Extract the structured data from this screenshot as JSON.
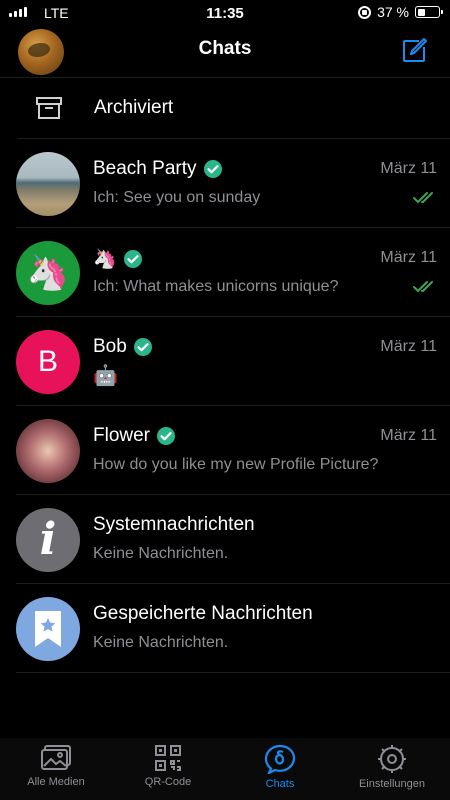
{
  "status_bar": {
    "carrier": "LTE",
    "time": "11:35",
    "battery": "37 %",
    "battery_level": 0.37
  },
  "header": {
    "title": "Chats"
  },
  "archived": {
    "label": "Archiviert"
  },
  "chats": [
    {
      "name": "Beach Party",
      "date": "März 11",
      "preview": "Ich: See you on sunday",
      "verified": true,
      "read": true
    },
    {
      "name": "🦄",
      "date": "März 11",
      "preview": "Ich: What makes unicorns unique?",
      "verified": true,
      "read": true,
      "avatar_emoji": "🦄",
      "avatar_color": "#1a9a3a"
    },
    {
      "name": "Bob",
      "date": "März 11",
      "preview": "🤖",
      "verified": true,
      "avatar_letter": "B",
      "avatar_color": "#e8125a"
    },
    {
      "name": "Flower",
      "date": "März 11",
      "preview": "How do you like my new Profile Picture?",
      "verified": true
    },
    {
      "name": "Systemnachrichten",
      "preview": "Keine Nachrichten.",
      "avatar_color": "#6d6d72"
    },
    {
      "name": "Gespeicherte Nachrichten",
      "preview": "Keine Nachrichten.",
      "avatar_color": "#7fa8e0"
    }
  ],
  "tabs": [
    {
      "label": "Alle Medien",
      "icon": "media-icon"
    },
    {
      "label": "QR-Code",
      "icon": "qr-code-icon"
    },
    {
      "label": "Chats",
      "icon": "chats-icon",
      "active": true
    },
    {
      "label": "Einstellungen",
      "icon": "gear-icon"
    }
  ],
  "colors": {
    "accent": "#1a8cf0",
    "verified": "#2bb58a",
    "read_check": "#3aa65a",
    "secondary_text": "#8f8f95"
  }
}
